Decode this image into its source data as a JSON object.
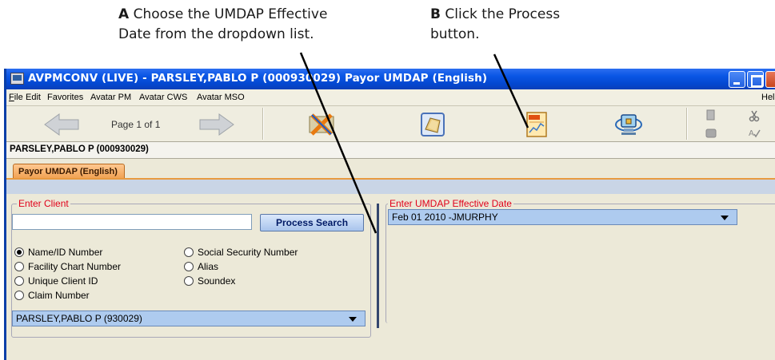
{
  "callouts": {
    "a_letter": "A",
    "a_line1": "Choose the UMDAP Effective",
    "a_line2": "Date from the dropdown list.",
    "b_letter": "B",
    "b_line1": "Click the Process",
    "b_line2": "button."
  },
  "window": {
    "title": "AVPMCONV (LIVE) - PARSLEY,PABLO P (000930029) Payor UMDAP (English)"
  },
  "menu": {
    "file": "File",
    "edit": "Edit",
    "favorites": "Favorites",
    "avatar_pm": "Avatar PM",
    "avatar_cws": "Avatar CWS",
    "avatar_mso": "Avatar MSO",
    "help": "Help"
  },
  "toolbar": {
    "page_label": "Page 1 of 1"
  },
  "client_bar": {
    "client": "PARSLEY,PABLO P (000930029)"
  },
  "tabs": {
    "active": "Payor UMDAP (English)"
  },
  "enter_client": {
    "legend": "Enter Client",
    "search_value": "",
    "search_button": "Process Search",
    "options": {
      "name_id": "Name/ID Number",
      "ssn": "Social Security Number",
      "facility_chart": "Facility Chart Number",
      "alias": "Alias",
      "unique_client": "Unique Client ID",
      "soundex": "Soundex",
      "claim": "Claim Number"
    },
    "selected_option": "Name/ID Number",
    "client_select": "PARSLEY,PABLO P (930029)"
  },
  "umdap": {
    "legend": "Enter UMDAP Effective Date",
    "selected": "Feb 01 2010 -JMURPHY"
  },
  "colors": {
    "title_bar": "#0a56e5",
    "legend_red": "#e0001a",
    "tab_orange": "#f0a050",
    "select_blue": "#aecbef"
  }
}
